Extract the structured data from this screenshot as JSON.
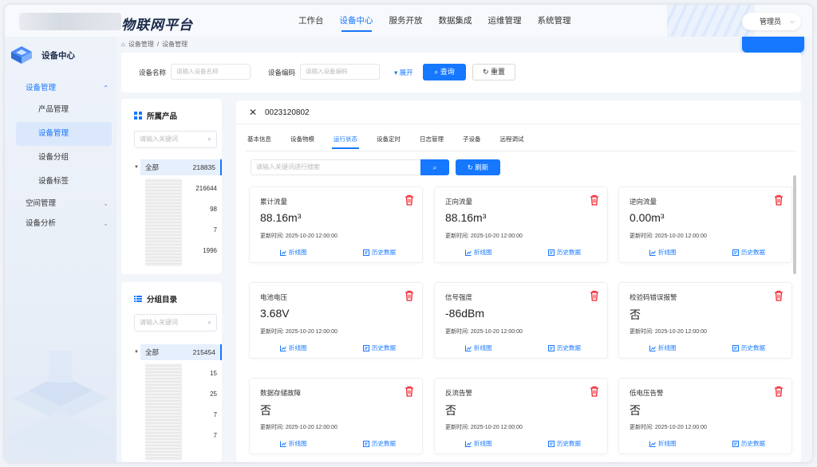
{
  "app": {
    "title": "物联网平台"
  },
  "topnav": [
    {
      "label": "工作台",
      "active": false
    },
    {
      "label": "设备中心",
      "active": true
    },
    {
      "label": "服务开放",
      "active": false
    },
    {
      "label": "数据集成",
      "active": false
    },
    {
      "label": "运维管理",
      "active": false
    },
    {
      "label": "系统管理",
      "active": false
    }
  ],
  "user": {
    "name": "管理员"
  },
  "sidebar": {
    "title": "设备中心",
    "items": [
      {
        "label": "设备管理"
      },
      {
        "label": "产品管理"
      },
      {
        "label": "设备管理"
      },
      {
        "label": "设备分组"
      },
      {
        "label": "设备标签"
      },
      {
        "label": "空间管理"
      },
      {
        "label": "设备分析"
      }
    ]
  },
  "breadcrumb": [
    "设备管理",
    "设备管理"
  ],
  "search": {
    "name_label": "设备名称",
    "name_placeholder": "请输入设备名称",
    "code_label": "设备编码",
    "code_placeholder": "请输入设备编码",
    "expand": "展开",
    "query": "查询",
    "reset": "重置"
  },
  "product_panel": {
    "title": "所属产品",
    "placeholder": "请输入关键词",
    "root_label": "全部",
    "root_count": "218835",
    "counts": [
      "216644",
      "98",
      "7",
      "1996"
    ]
  },
  "group_panel": {
    "title": "分组目录",
    "placeholder": "请输入关键词",
    "root_label": "全部",
    "root_count": "215454",
    "counts": [
      "15",
      "25",
      "7",
      "7"
    ]
  },
  "detail": {
    "device_id": "0023120802",
    "tabs": [
      "基本信息",
      "设备物模",
      "运行状态",
      "设备定时",
      "日志管理",
      "子设备",
      "远程调试"
    ],
    "active_tab": "运行状态",
    "search_placeholder": "请输入关键词进行搜索",
    "refresh": "刷新",
    "time_prefix": "更新时间:",
    "line_chart": "折线图",
    "history": "历史数据",
    "cards": [
      {
        "title": "累计流量",
        "value": "88.16m³",
        "time": "2025-10-20 12:00:00"
      },
      {
        "title": "正向流量",
        "value": "88.16m³",
        "time": "2025-10-20 12:00:00"
      },
      {
        "title": "逆向流量",
        "value": "0.00m³",
        "time": "2025-10-20 12:00:00"
      },
      {
        "title": "电池电压",
        "value": "3.68V",
        "time": "2025-10-20 12:00:00"
      },
      {
        "title": "信号强度",
        "value": "-86dBm",
        "time": "2025-10-20 12:00:00"
      },
      {
        "title": "校验码错误报警",
        "value": "否",
        "time": "2025-10-20 12:00:00"
      },
      {
        "title": "数据存储故障",
        "value": "否",
        "time": "2025-10-20 12:00:00"
      },
      {
        "title": "反流告警",
        "value": "否",
        "time": "2025-10-20 12:00:00"
      },
      {
        "title": "低电压告警",
        "value": "否",
        "time": "2025-10-20 12:00:00"
      }
    ]
  },
  "colors": {
    "primary": "#1677ff",
    "danger": "#f5222d"
  }
}
